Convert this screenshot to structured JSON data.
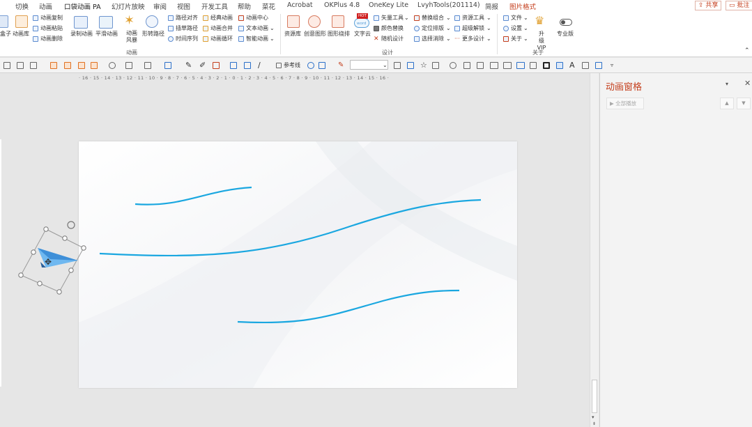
{
  "tabs": [
    "切换",
    "动画",
    "口袋动画 PA",
    "幻灯片放映",
    "审阅",
    "视图",
    "开发工具",
    "帮助",
    "菜花",
    "Acrobat",
    "OKPlus 4.8",
    "OneKey Lite",
    "LvyhTools(201114)",
    "简报",
    "图片格式"
  ],
  "top_buttons": {
    "share": "共享",
    "comment": "批注"
  },
  "ribbon": {
    "left_items": [
      "盒子",
      "动画库"
    ],
    "copy_items": [
      "动画复制",
      "动画粘贴",
      "动画删除"
    ],
    "record": [
      "录制动画",
      "平滑动画"
    ],
    "anim_style": "动画风暴",
    "shape_path": "形转路径",
    "path_col1": [
      "路径对齐",
      "插草路径",
      "时间序列"
    ],
    "path_col2": [
      "经典动画",
      "动画合并",
      "动画循环"
    ],
    "path_col3": [
      "动画中心",
      "文本动画",
      "智能动画"
    ],
    "group_anim": "动画",
    "design_big": [
      "资源库",
      "创意图形",
      "图形绕排",
      "文字云"
    ],
    "design_col1": [
      "矢量工具",
      "颜色替换",
      "随机设计"
    ],
    "design_col2": [
      "替换组合",
      "定位排版",
      "选择消除"
    ],
    "design_col3": [
      "资源工具",
      "超级解锁",
      "更多设计"
    ],
    "group_design": "设计",
    "about_col": [
      "文件",
      "设置",
      "关于"
    ],
    "upgrade": "升级VIP",
    "pro": "专业版",
    "group_about": "关于",
    "hot_badge": "HOT",
    "word_badge": "word"
  },
  "toolbar2": {
    "reference_line": "参考线"
  },
  "ruler_text": "· 16 · 15 · 14 · 13 · 12 · 11 · 10 · 9 · 8 · 7 · 6 · 5 · 4 · 3 · 2 · 1 · 0 · 1 · 2 · 3 · 4 · 5 · 6 · 7 · 8 · 9 · 10 · 11 · 12 · 13 · 14 · 15 · 16 ·",
  "pane": {
    "title": "动画窗格",
    "play_all": "全部播放"
  },
  "colors": {
    "accent": "#c43e1c",
    "path_line": "#1aa7e0",
    "plane": "#4aa3e8"
  }
}
